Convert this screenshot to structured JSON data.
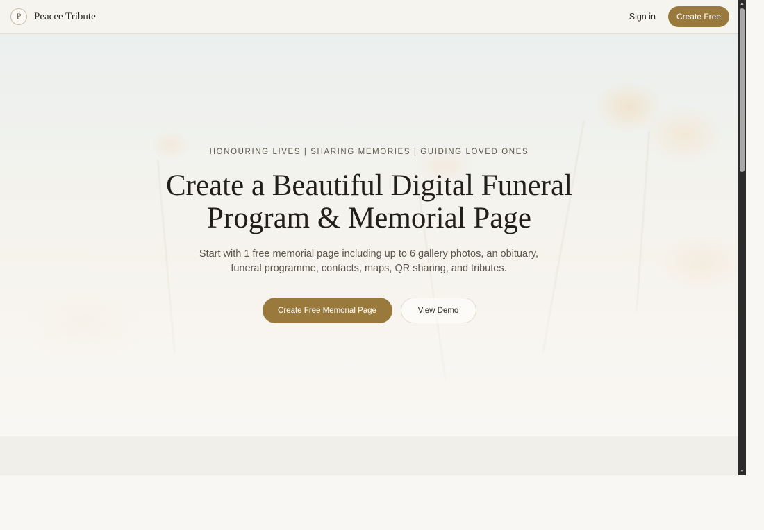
{
  "header": {
    "logo_text": "P",
    "brand_name": "Peacee Tribute",
    "sign_in_label": "Sign in",
    "create_free_label": "Create Free"
  },
  "hero": {
    "tagline": "HONOURING LIVES | SHARING MEMORIES | GUIDING LOVED ONES",
    "headline_line1": "Create a Beautiful Digital Funeral",
    "headline_line2": "Program & Memorial Page",
    "subtext_line1": "Start with 1 free memorial page including up to 6 gallery photos, an obituary,",
    "subtext_line2": "funeral programme, contacts, maps, QR sharing, and tributes.",
    "primary_cta": "Create Free Memorial Page",
    "secondary_cta": "View Demo"
  },
  "colors": {
    "accent": "#9a7a3c",
    "background": "#f9f7f3",
    "text": "#221e1a"
  },
  "scrollbar": {
    "up_arrow": "▲",
    "down_arrow": "▼"
  }
}
